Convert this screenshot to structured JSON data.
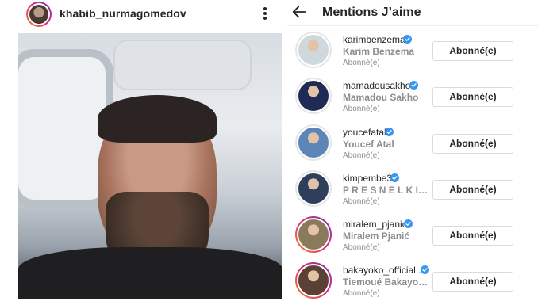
{
  "post": {
    "username": "khabib_nurmagomedov",
    "menu_icon": "kebab-icon"
  },
  "likes_screen": {
    "title": "Mentions J’aime",
    "back_icon": "arrow-left-icon",
    "users": [
      {
        "username": "karimbenzema",
        "full_name": "Karim Benzema",
        "status": "Abonné(e)",
        "button": "Abonné(e)",
        "verified": true,
        "story": false,
        "avatar_color": "#cfd8dc"
      },
      {
        "username": "mamadousakho",
        "full_name": "Mamadou Sakho",
        "status": "Abonné(e)",
        "button": "Abonné(e)",
        "verified": true,
        "story": false,
        "avatar_color": "#1f2b55"
      },
      {
        "username": "youcefatal",
        "full_name": "Youcef Atal",
        "status": "Abonné(e)",
        "button": "Abonné(e)",
        "verified": true,
        "story": false,
        "avatar_color": "#5c86b8"
      },
      {
        "username": "kimpembe3",
        "full_name": "P R E S N E L K I M ...",
        "status": "Abonné(e)",
        "button": "Abonné(e)",
        "verified": true,
        "story": false,
        "avatar_color": "#2f3e5c"
      },
      {
        "username": "miralem_pjanic",
        "full_name": "Miralem Pjanić",
        "status": "Abonné(e)",
        "button": "Abonné(e)",
        "verified": true,
        "story": true,
        "avatar_color": "#8a7a5c"
      },
      {
        "username": "bakayoko_official...",
        "full_name": "Tiemoué Bakayoko ...",
        "status": "Abonné(e)",
        "button": "Abonné(e)",
        "verified": true,
        "story": true,
        "avatar_color": "#5a4035"
      }
    ]
  },
  "colors": {
    "verified_blue": "#3897f0",
    "secondary_text": "#8e8e8e",
    "primary_text": "#262626"
  }
}
